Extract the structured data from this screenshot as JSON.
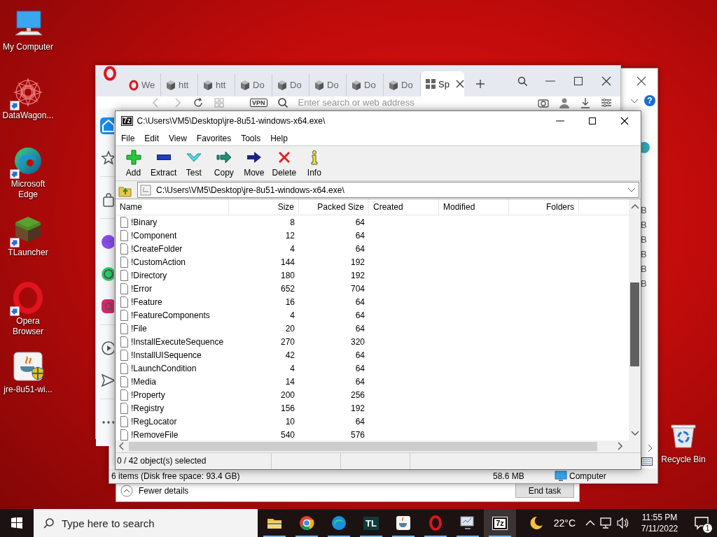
{
  "desktop_icons": [
    {
      "kind": "computer",
      "label": "My Computer",
      "shortcut": false
    },
    {
      "kind": "mandala",
      "label": "DataWagon...",
      "shortcut": true
    },
    {
      "kind": "edge",
      "label": "Microsoft Edge",
      "shortcut": true
    },
    {
      "kind": "cube",
      "label": "TLauncher",
      "shortcut": true
    },
    {
      "kind": "opera",
      "label": "Opera Browser",
      "shortcut": true
    },
    {
      "kind": "java",
      "label": "jre-8u51-wi...",
      "shortcut": false
    }
  ],
  "recycle_bin": {
    "label": "Recycle Bin"
  },
  "task_manager": {
    "details_toggle": "Fewer details",
    "end_task": "End task"
  },
  "explorer": {
    "help": "?",
    "column_letters": [
      "B",
      "B",
      "B",
      "B",
      "B",
      "B"
    ],
    "status": "6 items (Disk free space: 93.4 GB)",
    "size": "58.6 MB",
    "location": "Computer"
  },
  "browser": {
    "tabs": [
      {
        "kind": "opera",
        "label": "We",
        "selected": false
      },
      {
        "kind": "cube",
        "label": "htt",
        "selected": false
      },
      {
        "kind": "cube",
        "label": "htt",
        "selected": false
      },
      {
        "kind": "cube",
        "label": "Do",
        "selected": false
      },
      {
        "kind": "cube",
        "label": "Do",
        "selected": false
      },
      {
        "kind": "cube",
        "label": "Do",
        "selected": false
      },
      {
        "kind": "cube",
        "label": "Do",
        "selected": false
      },
      {
        "kind": "cube",
        "label": "Do",
        "selected": false
      },
      {
        "kind": "grid",
        "label": "Sp",
        "selected": true
      }
    ],
    "vpn": "VPN",
    "address_placeholder": "Enter search or web address",
    "sidebar": [
      {
        "kind": "home",
        "selected": true
      },
      {
        "kind": "star",
        "selected": false
      },
      {
        "kind": "bag",
        "selected": false
      },
      {
        "kind": "messenger",
        "selected": false
      },
      {
        "kind": "whatsapp",
        "selected": false
      },
      {
        "kind": "instagram",
        "selected": false
      },
      {
        "kind": "player",
        "selected": false
      },
      {
        "kind": "send",
        "selected": false
      },
      {
        "kind": "more",
        "selected": false
      }
    ]
  },
  "archive_window": {
    "logo": "7z",
    "title": "C:\\Users\\VM5\\Desktop\\jre-8u51-windows-x64.exe\\",
    "menu": [
      "File",
      "Edit",
      "View",
      "Favorites",
      "Tools",
      "Help"
    ],
    "toolbar": [
      {
        "kind": "add",
        "label": "Add"
      },
      {
        "kind": "extract",
        "label": "Extract"
      },
      {
        "kind": "test",
        "label": "Test"
      },
      {
        "kind": "copy",
        "label": "Copy"
      },
      {
        "kind": "move",
        "label": "Move"
      },
      {
        "kind": "delete",
        "label": "Delete"
      },
      {
        "kind": "info",
        "label": "Info"
      }
    ],
    "path": "C:\\Users\\VM5\\Desktop\\jre-8u51-windows-x64.exe\\",
    "columns": [
      "Name",
      "Size",
      "Packed Size",
      "Created",
      "Modified",
      "Folders"
    ],
    "rows": [
      {
        "name": "!Binary",
        "size": "8",
        "packed_size": "64"
      },
      {
        "name": "!Component",
        "size": "12",
        "packed_size": "64"
      },
      {
        "name": "!CreateFolder",
        "size": "4",
        "packed_size": "64"
      },
      {
        "name": "!CustomAction",
        "size": "144",
        "packed_size": "192"
      },
      {
        "name": "!Directory",
        "size": "180",
        "packed_size": "192"
      },
      {
        "name": "!Error",
        "size": "652",
        "packed_size": "704"
      },
      {
        "name": "!Feature",
        "size": "16",
        "packed_size": "64"
      },
      {
        "name": "!FeatureComponents",
        "size": "4",
        "packed_size": "64"
      },
      {
        "name": "!File",
        "size": "20",
        "packed_size": "64"
      },
      {
        "name": "!InstallExecuteSequence",
        "size": "270",
        "packed_size": "320"
      },
      {
        "name": "!InstallUISequence",
        "size": "42",
        "packed_size": "64"
      },
      {
        "name": "!LaunchCondition",
        "size": "4",
        "packed_size": "64"
      },
      {
        "name": "!Media",
        "size": "14",
        "packed_size": "64"
      },
      {
        "name": "!Property",
        "size": "200",
        "packed_size": "256"
      },
      {
        "name": "!Registry",
        "size": "156",
        "packed_size": "192"
      },
      {
        "name": "!RegLocator",
        "size": "10",
        "packed_size": "64"
      },
      {
        "name": "!RemoveFile",
        "size": "540",
        "packed_size": "576"
      }
    ],
    "status": "0 / 42 object(s) selected"
  },
  "taskbar": {
    "search_placeholder": "Type here to search",
    "apps": [
      {
        "kind": "folder",
        "running": true,
        "selected": false
      },
      {
        "kind": "chrome",
        "running": true,
        "selected": false
      },
      {
        "kind": "edge",
        "running": true,
        "selected": false
      },
      {
        "kind": "tl",
        "text": "TL",
        "running": true,
        "selected": false
      },
      {
        "kind": "java",
        "running": true,
        "selected": false
      },
      {
        "kind": "opera",
        "running": true,
        "selected": false
      },
      {
        "kind": "monitor",
        "running": true,
        "selected": false
      },
      {
        "kind": "sevenzip",
        "text": "7z",
        "running": true,
        "selected": true
      }
    ],
    "weather": "22°C",
    "time": "11:55 PM",
    "date": "7/11/2022",
    "notifications": "1"
  }
}
